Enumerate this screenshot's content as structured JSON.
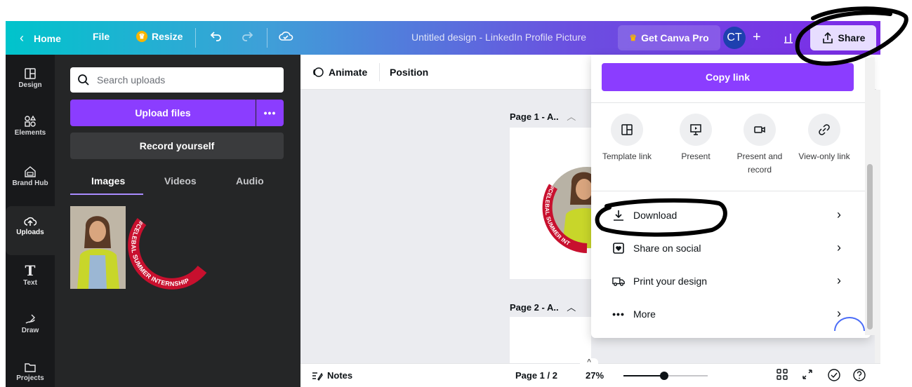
{
  "topbar": {
    "home_label": "Home",
    "file_label": "File",
    "resize_label": "Resize",
    "doc_title": "Untitled design - LinkedIn Profile Picture",
    "pro_label": "Get Canva Pro",
    "avatar_initials": "CT",
    "share_label": "Share"
  },
  "rail": {
    "items": [
      {
        "label": "Design",
        "icon": "layout-icon"
      },
      {
        "label": "Elements",
        "icon": "shapes-icon"
      },
      {
        "label": "Brand Hub",
        "icon": "brand-icon"
      },
      {
        "label": "Uploads",
        "icon": "cloud-upload-icon"
      },
      {
        "label": "Text",
        "icon": "text-icon"
      },
      {
        "label": "Draw",
        "icon": "draw-icon"
      },
      {
        "label": "Projects",
        "icon": "folder-icon"
      }
    ]
  },
  "panel": {
    "search_placeholder": "Search uploads",
    "upload_label": "Upload files",
    "more_label": "•••",
    "record_label": "Record yourself",
    "tabs": [
      "Images",
      "Videos",
      "Audio"
    ],
    "arc_text": "#CELEBAL SUMMER INTERNSHIP"
  },
  "canvas": {
    "animate_label": "Animate",
    "position_label": "Position",
    "page1_label": "Page 1 - A..",
    "page2_label": "Page 2 - A..",
    "page1_arc_text": "#CELEBAL SUMMER INT"
  },
  "bottombar": {
    "notes_label": "Notes",
    "page_indicator": "Page 1 / 2",
    "zoom_label": "27%",
    "zoom_fraction": 0.27
  },
  "share_menu": {
    "copy_link_label": "Copy link",
    "options": [
      {
        "label": "Template link",
        "icon": "template-icon"
      },
      {
        "label": "Present",
        "icon": "present-icon"
      },
      {
        "label": "Present and record",
        "icon": "camera-icon"
      },
      {
        "label": "View-only link",
        "icon": "link-icon"
      }
    ],
    "rows": [
      {
        "label": "Download",
        "icon": "download-icon"
      },
      {
        "label": "Share on social",
        "icon": "heart-icon"
      },
      {
        "label": "Print your design",
        "icon": "truck-icon"
      },
      {
        "label": "More",
        "icon": "dots-icon"
      }
    ]
  },
  "colors": {
    "purple": "#8b3dff",
    "rail_bg": "#18191b",
    "panel_bg": "#252627",
    "arc_red": "#c8102e"
  }
}
